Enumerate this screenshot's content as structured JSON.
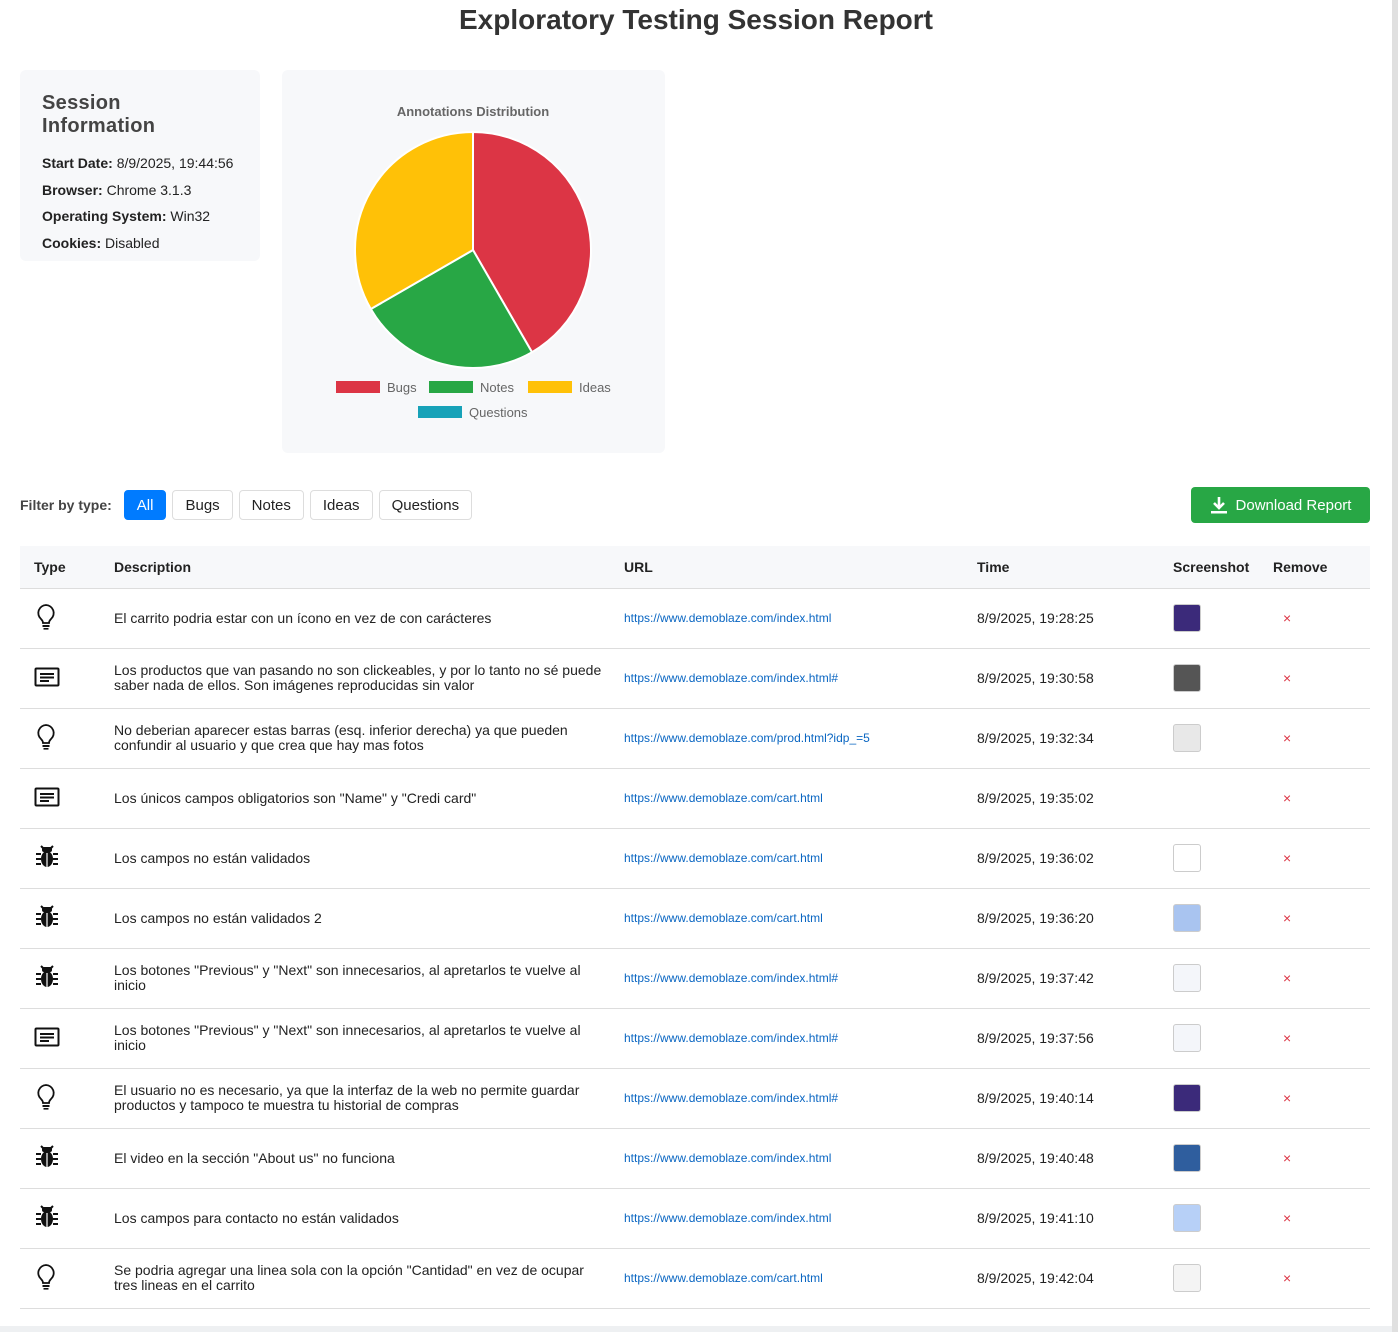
{
  "title": "Exploratory Testing Session Report",
  "session": {
    "heading": "Session Information",
    "fields": [
      {
        "label": "Start Date:",
        "value": "8/9/2025, 19:44:56"
      },
      {
        "label": "Browser:",
        "value": "Chrome 3.1.3"
      },
      {
        "label": "Operating System:",
        "value": "Win32"
      },
      {
        "label": "Cookies:",
        "value": "Disabled"
      }
    ]
  },
  "chart_data": {
    "type": "pie",
    "title": "Annotations Distribution",
    "categories": [
      "Bugs",
      "Notes",
      "Ideas",
      "Questions"
    ],
    "values": [
      5,
      3,
      4,
      0
    ],
    "colors": [
      "#dc3545",
      "#28a745",
      "#ffc107",
      "#17a2b8"
    ],
    "legend": "bottom"
  },
  "filter": {
    "label": "Filter by type:",
    "buttons": [
      "All",
      "Bugs",
      "Notes",
      "Ideas",
      "Questions"
    ],
    "active": "All"
  },
  "download_label": "Download Report",
  "table": {
    "headers": [
      "Type",
      "Description",
      "URL",
      "Time",
      "Screenshot",
      "Remove"
    ],
    "rows": [
      {
        "type": "idea",
        "description": "El carrito podria estar con un ícono en vez de con carácteres",
        "url": "https://www.demoblaze.com/index.html",
        "time": "8/9/2025, 19:28:25",
        "thumb": "#3b2a7a"
      },
      {
        "type": "note",
        "description": "Los productos que van pasando no son clickeables, y por lo tanto no sé puede saber nada de ellos. Son imágenes reproducidas sin valor",
        "url": "https://www.demoblaze.com/index.html#",
        "time": "8/9/2025, 19:30:58",
        "thumb": "#555555"
      },
      {
        "type": "idea",
        "description": "No deberian aparecer estas barras (esq. inferior derecha) ya que pueden confundir al usuario y que crea que hay mas fotos",
        "url": "https://www.demoblaze.com/prod.html?idp_=5",
        "time": "8/9/2025, 19:32:34",
        "thumb": "#e8e8e8"
      },
      {
        "type": "note",
        "description": "Los únicos campos obligatorios son \"Name\" y \"Credi card\"",
        "url": "https://www.demoblaze.com/cart.html",
        "time": "8/9/2025, 19:35:02",
        "thumb": ""
      },
      {
        "type": "bug",
        "description": "Los campos no están validados",
        "url": "https://www.demoblaze.com/cart.html",
        "time": "8/9/2025, 19:36:02",
        "thumb": "#ffffff"
      },
      {
        "type": "bug",
        "description": "Los campos no están validados 2",
        "url": "https://www.demoblaze.com/cart.html",
        "time": "8/9/2025, 19:36:20",
        "thumb": "#a9c4f0"
      },
      {
        "type": "bug",
        "description": "Los botones \"Previous\" y \"Next\" son innecesarios, al apretarlos te vuelve al inicio",
        "url": "https://www.demoblaze.com/index.html#",
        "time": "8/9/2025, 19:37:42",
        "thumb": "#f4f6fa"
      },
      {
        "type": "note",
        "description": "Los botones \"Previous\" y \"Next\" son innecesarios, al apretarlos te vuelve al inicio",
        "url": "https://www.demoblaze.com/index.html#",
        "time": "8/9/2025, 19:37:56",
        "thumb": "#f4f6fa"
      },
      {
        "type": "idea",
        "description": "El usuario no es necesario, ya que la interfaz de la web no permite guardar productos y tampoco te muestra tu historial de compras",
        "url": "https://www.demoblaze.com/index.html#",
        "time": "8/9/2025, 19:40:14",
        "thumb": "#3b2a7a"
      },
      {
        "type": "bug",
        "description": "El video en la sección \"About us\" no funciona",
        "url": "https://www.demoblaze.com/index.html",
        "time": "8/9/2025, 19:40:48",
        "thumb": "#2f5e9e"
      },
      {
        "type": "bug",
        "description": "Los campos para contacto no están validados",
        "url": "https://www.demoblaze.com/index.html",
        "time": "8/9/2025, 19:41:10",
        "thumb": "#b7d0f7"
      },
      {
        "type": "idea",
        "description": "Se podria agregar una linea sola con la opción \"Cantidad\" en vez de ocupar tres lineas en el carrito",
        "url": "https://www.demoblaze.com/cart.html",
        "time": "8/9/2025, 19:42:04",
        "thumb": "#f4f4f4"
      }
    ],
    "remove_symbol": "×"
  }
}
